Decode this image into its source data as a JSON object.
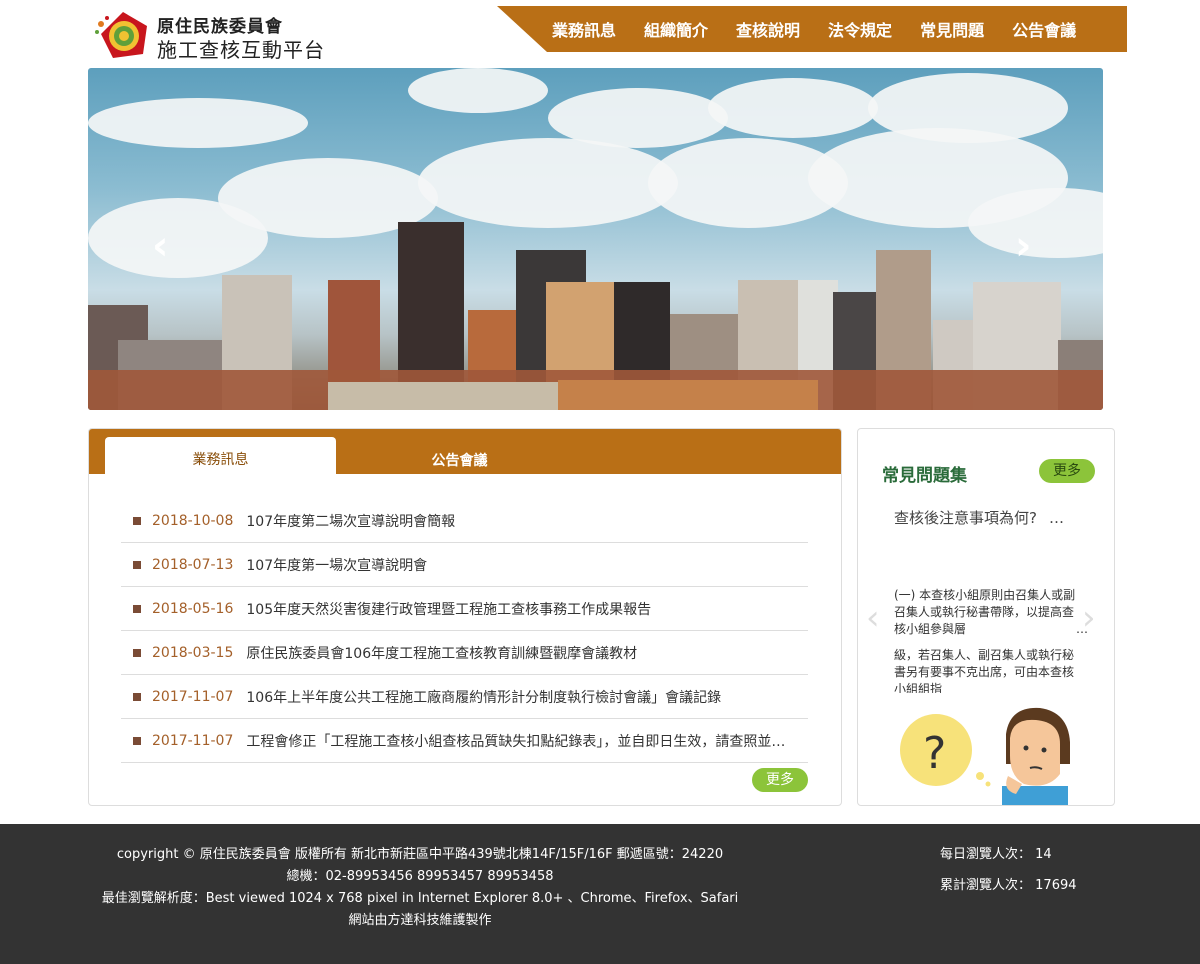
{
  "header": {
    "logo_line1": "原住民族委員會",
    "logo_line2": "施工查核互動平台",
    "nav": [
      "業務訊息",
      "組織簡介",
      "查核說明",
      "法令規定",
      "常見問題",
      "公告會議"
    ]
  },
  "banner": {
    "prev_icon": "chevron-left",
    "next_icon": "chevron-right"
  },
  "news": {
    "tabs": [
      "業務訊息",
      "公告會議"
    ],
    "items": [
      {
        "date": "2018-10-08",
        "title": "107年度第二場次宣導說明會簡報"
      },
      {
        "date": "2018-07-13",
        "title": "107年度第一場次宣導說明會"
      },
      {
        "date": "2018-05-16",
        "title": "105年度天然災害復建行政管理暨工程施工查核事務工作成果報告"
      },
      {
        "date": "2018-03-15",
        "title": "原住民族委員會106年度工程施工查核教育訓練暨觀摩會議教材"
      },
      {
        "date": "2017-11-07",
        "title": "106年上半年度公共工程施工廠商履約情形計分制度執行檢討會議」會議記錄"
      },
      {
        "date": "2017-11-07",
        "title": "工程會修正「工程施工查核小組查核品質缺失扣點紀錄表」，並自即日生效，請查照並…"
      }
    ],
    "more_label": "更多"
  },
  "faq": {
    "title": "常見問題集",
    "more_label": "更多",
    "question": "查核後注意事項為何?",
    "question_ellipsis": "…",
    "answer_1": "(一) 本查核小組原則由召集人或副召集人或執行秘書帶隊，以提高查核小組參與層",
    "answer_1_ellipsis": "…",
    "answer_2": "級，若召集人、副召集人或執行秘書另有要事不克出席，可由本查核小組組指",
    "prev_icon": "chevron-left",
    "next_icon": "chevron-right"
  },
  "footer": {
    "line1": "copyright © 原住民族委員會 版權所有 新北市新莊區中平路439號北棟14F/15F/16F 郵遞區號：24220",
    "line2": "總機：02-89953456 89953457 89953458",
    "line3": "最佳瀏覽解析度：Best viewed 1024 x 768 pixel in Internet Explorer 8.0+ 、Chrome、Firefox、Safari",
    "line4": "網站由方達科技維護製作",
    "daily_label": "每日瀏覽人次：",
    "daily_value": "14",
    "total_label": "累計瀏覽人次：",
    "total_value": "17694"
  },
  "colors": {
    "brand_orange": "#b96f16",
    "more_green": "#8cc43a",
    "date_brown": "#a4602a",
    "footer_bg": "#333333"
  }
}
